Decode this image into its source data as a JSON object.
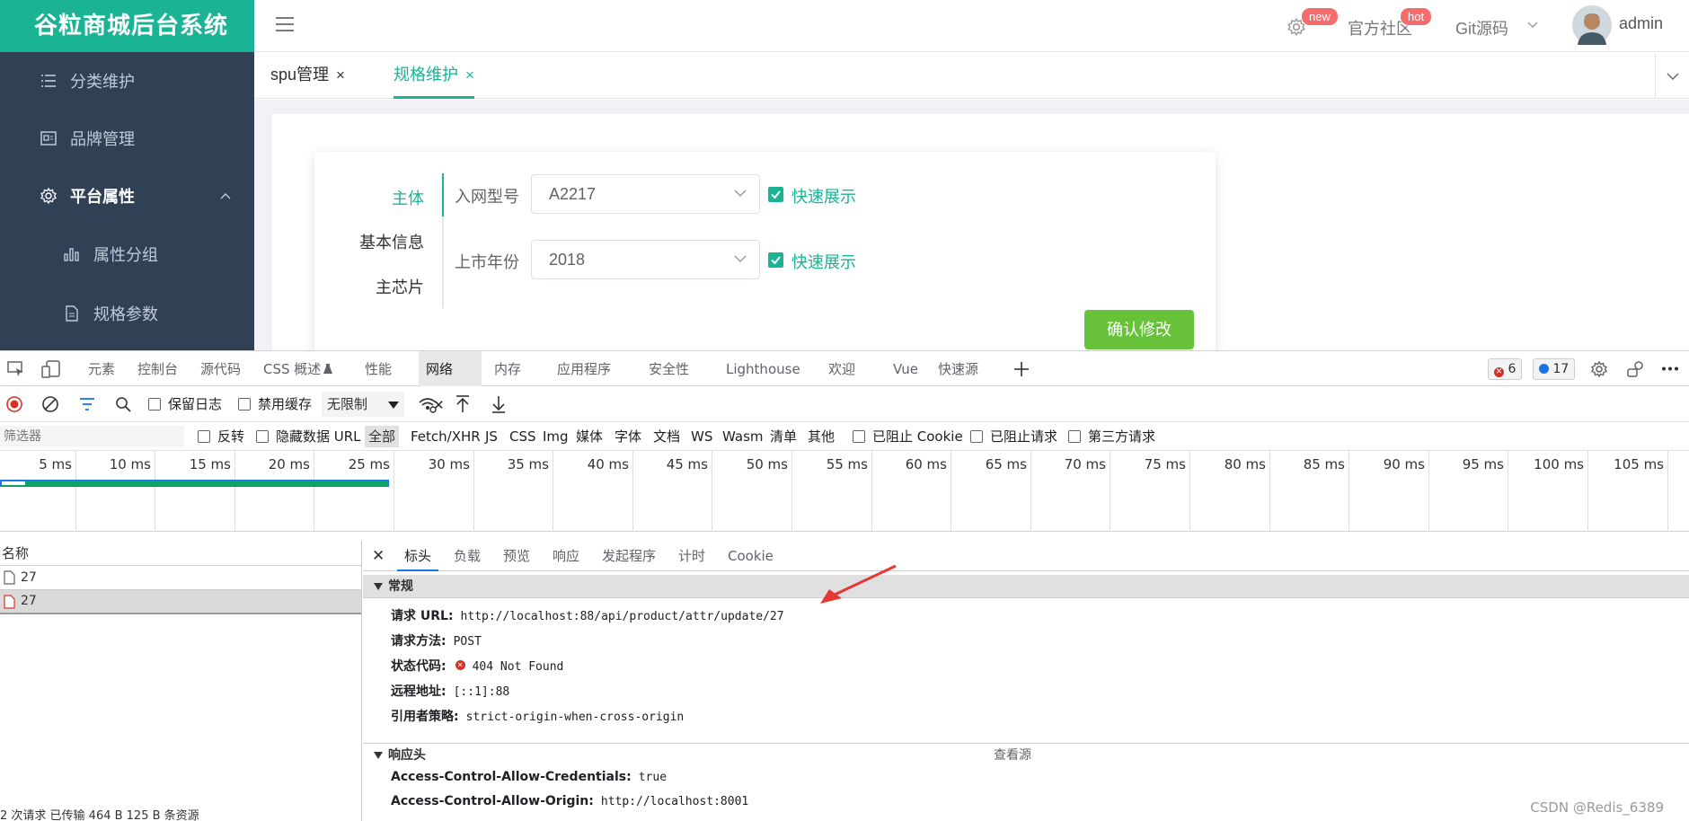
{
  "app": {
    "title": "谷粒商城后台系统",
    "menu": [
      {
        "label": "分类维护",
        "icon": "list-icon"
      },
      {
        "label": "品牌管理",
        "icon": "table-icon"
      },
      {
        "label": "平台属性",
        "icon": "gear-icon",
        "expanded": true
      }
    ],
    "submenu": [
      {
        "label": "属性分组",
        "icon": "bar-chart-icon"
      },
      {
        "label": "规格参数",
        "icon": "document-icon"
      }
    ],
    "topbar": {
      "badge_new": "new",
      "community": "官方社区",
      "badge_hot": "hot",
      "git": "Git源码",
      "user": "admin"
    },
    "tabs": [
      {
        "label": "spu管理",
        "close": "×",
        "active": false
      },
      {
        "label": "规格维护",
        "close": "×",
        "active": true
      }
    ],
    "form": {
      "vtabs": [
        "主体",
        "基本信息",
        "主芯片"
      ],
      "fields": [
        {
          "label": "入网型号",
          "value": "A2217",
          "check_label": "快速展示"
        },
        {
          "label": "上市年份",
          "value": "2018",
          "check_label": "快速展示"
        }
      ],
      "submit": "确认修改"
    },
    "colors": {
      "brand": "#1ab394",
      "sidebar": "#304156",
      "success": "#67c23a",
      "danger": "#f56c6c"
    }
  },
  "devtools": {
    "tabs": [
      "元素",
      "控制台",
      "源代码",
      "CSS 概述",
      "性能",
      "网络",
      "内存",
      "应用程序",
      "安全性",
      "Lighthouse",
      "欢迎",
      "Vue",
      "快速源"
    ],
    "errors": "6",
    "messages": "17",
    "toolbar": {
      "preserve_log": "保留日志",
      "disable_cache": "禁用缓存",
      "throttle": "无限制"
    },
    "filter": {
      "placeholder": "筛选器",
      "invert": "反转",
      "hide_data": "隐藏数据 URL",
      "types": [
        "全部",
        "Fetch/XHR",
        "JS",
        "CSS",
        "Img",
        "媒体",
        "字体",
        "文档",
        "WS",
        "Wasm",
        "清单",
        "其他"
      ],
      "blocked_cookie": "已阻止 Cookie",
      "blocked_req": "已阻止请求",
      "third_party": "第三方请求"
    },
    "timeline_ticks": [
      "5 ms",
      "10 ms",
      "15 ms",
      "20 ms",
      "25 ms",
      "30 ms",
      "35 ms",
      "40 ms",
      "45 ms",
      "50 ms",
      "55 ms",
      "60 ms",
      "65 ms",
      "70 ms",
      "75 ms",
      "80 ms",
      "85 ms",
      "90 ms",
      "95 ms",
      "100 ms",
      "105 ms"
    ],
    "requests_header": "名称",
    "requests": [
      "27",
      "27"
    ],
    "detail_tabs": [
      "标头",
      "负载",
      "预览",
      "响应",
      "发起程序",
      "计时",
      "Cookie"
    ],
    "general": {
      "title": "常规",
      "rows": [
        {
          "k": "请求 URL:",
          "v": "http://localhost:88/api/product/attr/update/27"
        },
        {
          "k": "请求方法:",
          "v": "POST"
        },
        {
          "k": "状态代码:",
          "v": "404 Not Found"
        },
        {
          "k": "远程地址:",
          "v": "[::1]:88"
        },
        {
          "k": "引用者策略:",
          "v": "strict-origin-when-cross-origin"
        }
      ]
    },
    "response_headers": {
      "title": "响应头",
      "view_source": "查看源",
      "rows": [
        {
          "k": "Access-Control-Allow-Credentials:",
          "v": "true"
        },
        {
          "k": "Access-Control-Allow-Origin:",
          "v": "http://localhost:8001"
        }
      ]
    },
    "status_bar": "2 次请求  已传输 464 B  125 B 条资源"
  },
  "watermark": "CSDN @Redis_6389"
}
